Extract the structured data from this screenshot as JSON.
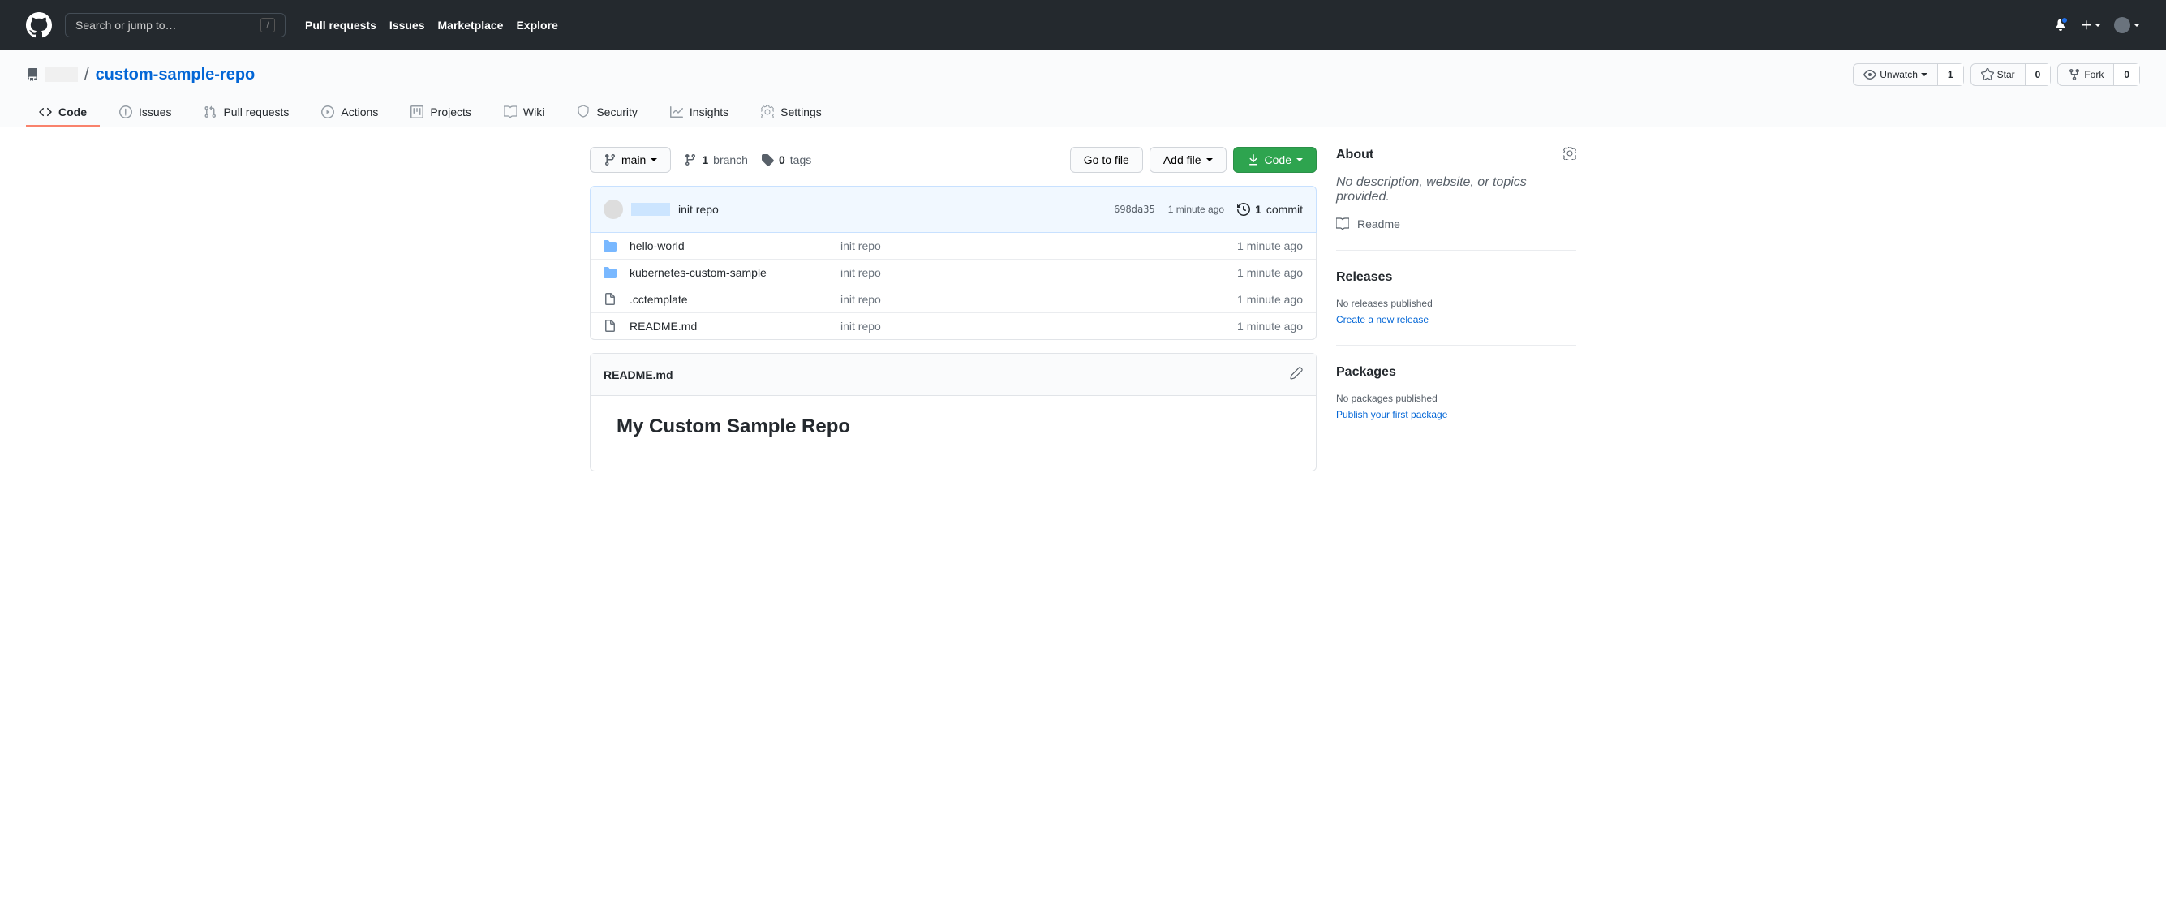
{
  "header": {
    "search_placeholder": "Search or jump to…",
    "slash_hint": "/",
    "nav": [
      "Pull requests",
      "Issues",
      "Marketplace",
      "Explore"
    ]
  },
  "repo": {
    "separator": "/",
    "name": "custom-sample-repo",
    "actions": {
      "watch": {
        "label": "Unwatch",
        "count": "1"
      },
      "star": {
        "label": "Star",
        "count": "0"
      },
      "fork": {
        "label": "Fork",
        "count": "0"
      }
    }
  },
  "tabs": {
    "code": "Code",
    "issues": "Issues",
    "pulls": "Pull requests",
    "actions": "Actions",
    "projects": "Projects",
    "wiki": "Wiki",
    "security": "Security",
    "insights": "Insights",
    "settings": "Settings"
  },
  "file_nav": {
    "branch": "main",
    "branch_count": "1",
    "branch_label": "branch",
    "tag_count": "0",
    "tag_label": "tags",
    "go_to_file": "Go to file",
    "add_file": "Add file",
    "code_btn": "Code"
  },
  "commit": {
    "message": "init repo",
    "sha": "698da35",
    "time": "1 minute ago",
    "commits_count": "1",
    "commits_label": "commit"
  },
  "files": [
    {
      "type": "dir",
      "name": "hello-world",
      "msg": "init repo",
      "time": "1 minute ago"
    },
    {
      "type": "dir",
      "name": "kubernetes-custom-sample",
      "msg": "init repo",
      "time": "1 minute ago"
    },
    {
      "type": "file",
      "name": ".cctemplate",
      "msg": "init repo",
      "time": "1 minute ago"
    },
    {
      "type": "file",
      "name": "README.md",
      "msg": "init repo",
      "time": "1 minute ago"
    }
  ],
  "readme": {
    "filename": "README.md",
    "heading": "My Custom Sample Repo"
  },
  "sidebar": {
    "about": {
      "title": "About",
      "description": "No description, website, or topics provided.",
      "readme_link": "Readme"
    },
    "releases": {
      "title": "Releases",
      "empty": "No releases published",
      "create": "Create a new release"
    },
    "packages": {
      "title": "Packages",
      "empty": "No packages published",
      "publish": "Publish your first package"
    }
  }
}
